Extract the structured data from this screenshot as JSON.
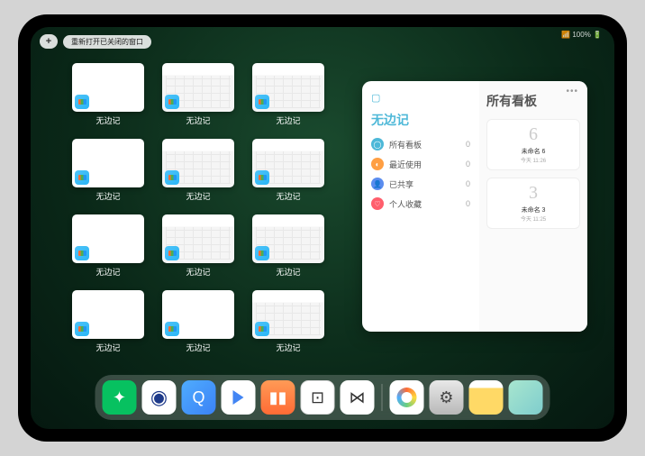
{
  "status": "📶 100% 🔋",
  "topbar": {
    "plus": "+",
    "pill": "重新打开已关闭的窗口"
  },
  "thumbs": [
    {
      "type": "blank",
      "label": "无边记"
    },
    {
      "type": "cal",
      "label": "无边记"
    },
    {
      "type": "cal",
      "label": "无边记"
    },
    {
      "type": "blank",
      "label": "无边记"
    },
    {
      "type": "cal",
      "label": "无边记"
    },
    {
      "type": "cal",
      "label": "无边记"
    },
    {
      "type": "blank",
      "label": "无边记"
    },
    {
      "type": "cal",
      "label": "无边记"
    },
    {
      "type": "cal",
      "label": "无边记"
    },
    {
      "type": "blank",
      "label": "无边记"
    },
    {
      "type": "blank",
      "label": "无边记"
    },
    {
      "type": "cal",
      "label": "无边记"
    }
  ],
  "panel": {
    "dots": "•••",
    "left": {
      "title": "无边记",
      "rows": [
        {
          "icon": "◯",
          "cls": "r1",
          "label": "所有看板",
          "count": "0"
        },
        {
          "icon": "◐",
          "cls": "r2",
          "label": "最近使用",
          "count": "0"
        },
        {
          "icon": "👤",
          "cls": "r3",
          "label": "已共享",
          "count": "0"
        },
        {
          "icon": "♡",
          "cls": "r4",
          "label": "个人收藏",
          "count": "0"
        }
      ]
    },
    "right": {
      "title": "所有看板",
      "cards": [
        {
          "sketch": "6",
          "name": "未命名 6",
          "date": "今天 11:26"
        },
        {
          "sketch": "3",
          "name": "未命名 3",
          "date": "今天 11:25"
        }
      ]
    }
  },
  "dock": [
    {
      "name": "wechat",
      "cls": "d1",
      "glyph": "✦"
    },
    {
      "name": "quark",
      "cls": "d2",
      "glyph": "◉"
    },
    {
      "name": "browser",
      "cls": "d3",
      "glyph": "Q"
    },
    {
      "name": "play",
      "cls": "d4",
      "glyph": ""
    },
    {
      "name": "books",
      "cls": "d5",
      "glyph": "▮▮"
    },
    {
      "name": "dice",
      "cls": "d6",
      "glyph": "⊡"
    },
    {
      "name": "connect",
      "cls": "d7",
      "glyph": "⋈"
    },
    {
      "name": "divider"
    },
    {
      "name": "freeform",
      "cls": "d8",
      "glyph": ""
    },
    {
      "name": "settings",
      "cls": "d9",
      "glyph": "⚙"
    },
    {
      "name": "notes",
      "cls": "d10",
      "glyph": ""
    },
    {
      "name": "library",
      "cls": "d11",
      "glyph": ""
    }
  ]
}
